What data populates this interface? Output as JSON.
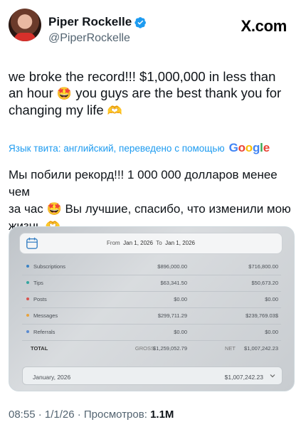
{
  "author": {
    "name": "Piper Rockelle",
    "handle": "@PiperRockelle"
  },
  "site_logo": "X.com",
  "tweet": {
    "line1": "we broke the record!!! $1,000,000 in less than",
    "line2a": "an hour",
    "emoji1": "🤩",
    "line2b": "you guys are the best thank you for",
    "line3": "changing my life",
    "emoji2": "🫶"
  },
  "translation": {
    "bar_text": "Язык твита: английский, переведено с помощью",
    "provider": "Google",
    "line1": "Мы побили рекорд!!! 1 000 000 долларов менее чем",
    "line2a": "за час",
    "emoji1": "🤩",
    "line2b": "Вы лучшие, спасибо, что изменили мою",
    "line3": "жизнь",
    "emoji2": "🫶"
  },
  "earnings": {
    "from_label": "From",
    "from_date": "Jan 1, 2026",
    "to_label": "To",
    "to_date": "Jan 1, 2026",
    "rows": [
      {
        "label": "Subscriptions",
        "gross": "$896,000.00",
        "net": "$716,800.00",
        "color": "#3b82c4"
      },
      {
        "label": "Tips",
        "gross": "$63,341.50",
        "net": "$50,673.20",
        "color": "#35a6a0"
      },
      {
        "label": "Posts",
        "gross": "$0.00",
        "net": "$0.00",
        "color": "#d9534f"
      },
      {
        "label": "Messages",
        "gross": "$299,711.29",
        "net": "$239,769.03$",
        "color": "#e8a33d"
      },
      {
        "label": "Referrals",
        "gross": "$0.00",
        "net": "$0.00",
        "color": "#5b8bd0"
      }
    ],
    "total": {
      "label": "TOTAL",
      "gross_label": "GROSS",
      "gross": "$1,259,052.79",
      "net_label": "NET",
      "net": "$1,007,242.23"
    },
    "month": {
      "label": "January, 2026",
      "value": "$1,007,242.23"
    }
  },
  "meta": {
    "time_date": "08:55 · 1/1/26 · Просмотров:",
    "views": "1.1M"
  }
}
